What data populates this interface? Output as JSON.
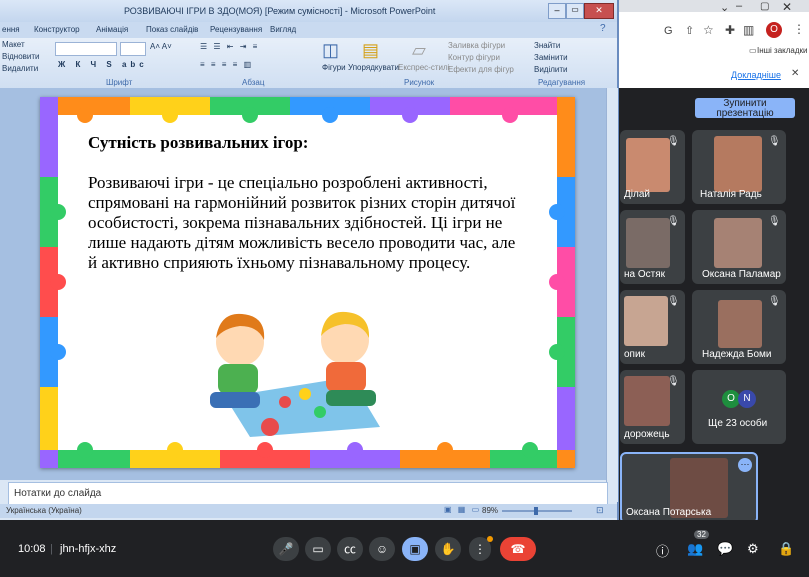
{
  "ppt": {
    "title": "РОЗВИВАЮЧІ ІГРИ В ЗДО(МОЯ) [Режим сумісності] - Microsoft PowerPoint",
    "tabs": [
      "ення",
      "Конструктор",
      "Анімація",
      "Показ слайдів",
      "Рецензування",
      "Вигляд"
    ],
    "ribbon": {
      "maket": "Макет",
      "vidnovyty": "Відновити",
      "vydalyty": "Видалити",
      "shryft": "Шрифт",
      "abzats": "Абзац",
      "figury": "Фігури",
      "uporiadkuvaty": "Упорядкувати",
      "ekspres": "Експрес-стилі",
      "zalyvka": "Заливка фігури",
      "kontur": "Контур фігури",
      "efekty": "Ефекти для фігур",
      "malunok": "Рисунок",
      "znaity": "Знайти",
      "zaminyty": "Замінити",
      "vydilyty": "Виділити",
      "redaguvannia": "Редагування"
    },
    "slide": {
      "heading": "Сутність розвивальних ігор:",
      "body": "Розвиваючі ігри - це спеціально розроблені активності, спрямовані на гармонійний розвиток різних сторін дитячої особистості, зокрема пізнавальних здібностей. Ці ігри не лише надають дітям можливість весело проводити час, але й активно сприяють їхньому пізнавальному процесу."
    },
    "notes": "Нотатки до слайда",
    "status_lang": "Українська (Україна)",
    "zoom": "89%"
  },
  "browser": {
    "bookmarks": "Інші закладки",
    "details": "Докладніше",
    "stop_presenting": "Зупинити презентацію"
  },
  "participants": [
    {
      "name": "Ділай"
    },
    {
      "name": "Наталія Радь"
    },
    {
      "name": "на Остяк"
    },
    {
      "name": "Оксана Паламар"
    },
    {
      "name": "опик"
    },
    {
      "name": "Надежда Боми"
    },
    {
      "name": "дорожець"
    },
    {
      "name": "Ще 23 особи"
    },
    {
      "name": "Оксана Потарська"
    }
  ],
  "others_initials": [
    "O",
    "N"
  ],
  "meet": {
    "time": "10:08",
    "code": "jhn-hfjx-xhz",
    "people_count": "32"
  },
  "colors": {
    "stop_btn": "#8ab4f8",
    "end_call": "#ea4335",
    "present_active": "#8ab4f8"
  }
}
